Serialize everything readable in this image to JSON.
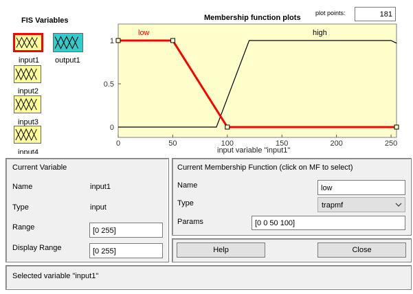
{
  "fis": {
    "title": "FIS Variables",
    "items": [
      {
        "label": "input1",
        "selected": true
      },
      {
        "label": "output1",
        "selected": false
      },
      {
        "label": "input2",
        "selected": false
      },
      {
        "label": "input3",
        "selected": false
      },
      {
        "label": "input4",
        "selected": false
      }
    ]
  },
  "plot": {
    "title": "Membership function plots",
    "points_label": "plot points:",
    "points_value": "181",
    "x_label": "input variable \"input1\"",
    "x_ticks": [
      "0",
      "50",
      "100",
      "150",
      "200",
      "250"
    ],
    "y_ticks": [
      "0",
      "0.5",
      "1"
    ],
    "mf_labels": [
      "low",
      "high"
    ]
  },
  "chart_data": {
    "type": "line",
    "xlabel": "input variable \"input1\"",
    "ylabel": "",
    "xlim": [
      0,
      255
    ],
    "ylim": [
      0,
      1
    ],
    "series": [
      {
        "name": "low",
        "x": [
          0,
          50,
          100,
          255
        ],
        "y": [
          1,
          1,
          0,
          0
        ],
        "color": "#ff0000"
      },
      {
        "name": "high",
        "x": [
          0,
          90,
          120,
          250,
          255
        ],
        "y": [
          0,
          0,
          1,
          1,
          0.97
        ],
        "color": "#000000"
      }
    ]
  },
  "variable": {
    "title": "Current Variable",
    "name_label": "Name",
    "name_value": "input1",
    "type_label": "Type",
    "type_value": "input",
    "range_label": "Range",
    "range_value": "[0 255]",
    "display_range_label": "Display Range",
    "display_range_value": "[0 255]"
  },
  "mf": {
    "title": "Current Membership Function (click on MF to select)",
    "name_label": "Name",
    "name_value": "low",
    "type_label": "Type",
    "type_value": "trapmf",
    "params_label": "Params",
    "params_value": "[0 0 50 100]"
  },
  "buttons": {
    "help": "Help",
    "close": "Close"
  },
  "status": "Selected variable \"input1\"",
  "colors": {
    "plot_bg": "#ffffcc",
    "selected_border": "#ff0000",
    "input_tile": "#ffff99",
    "output_tile": "#33cccc",
    "low_mf": "#ff0000"
  }
}
